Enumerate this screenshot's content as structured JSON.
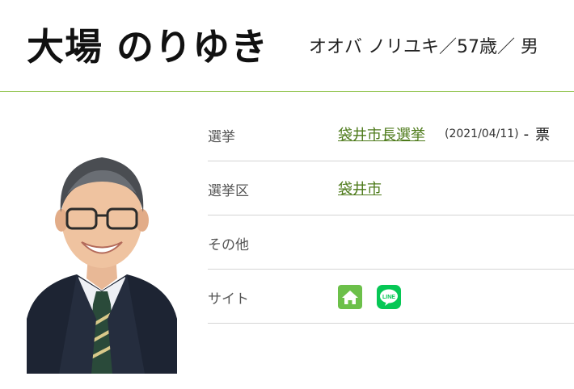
{
  "candidate": {
    "name": "大場 のりゆき",
    "kana_info": "オオバ ノリユキ／57歳／ 男"
  },
  "profile": {
    "rows": [
      {
        "label": "選挙",
        "election_link": "袋井市長選挙",
        "date": "(2021/04/11)",
        "dash": "-",
        "votes": "票"
      },
      {
        "label": "選挙区",
        "district_link": "袋井市"
      },
      {
        "label": "その他"
      },
      {
        "label": "サイト",
        "sites": [
          "home-icon",
          "line-icon"
        ]
      }
    ]
  },
  "line_icon_text": "LINE",
  "colors": {
    "divider": "#8fc24a",
    "link": "#4d7a1a",
    "home_icon_bg": "#6cc04a",
    "line_icon_bg": "#06c755"
  }
}
